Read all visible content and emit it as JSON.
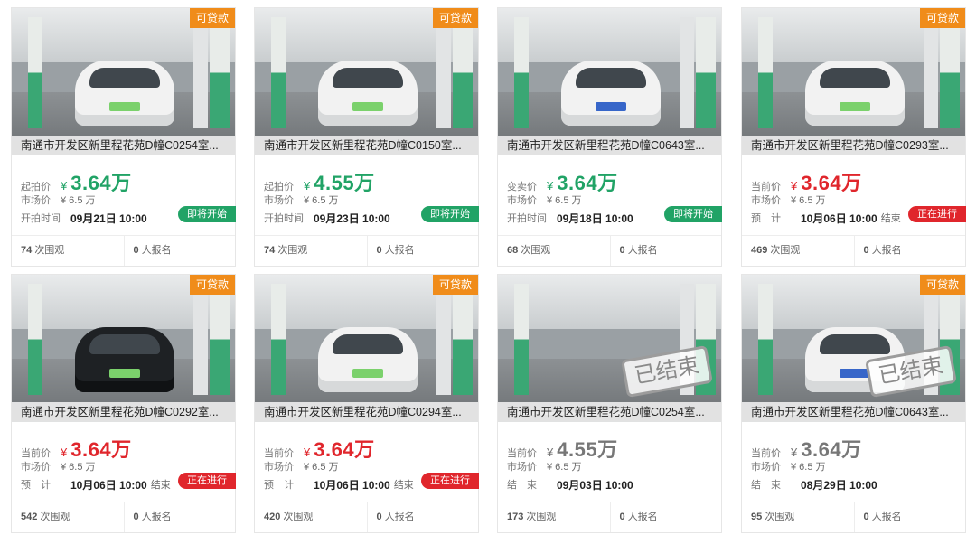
{
  "labels": {
    "market_price": "市场价",
    "views_suffix": "次围观",
    "signups_suffix": "人报名",
    "yen": "¥",
    "loan": "可贷款",
    "ended": "已结束"
  },
  "colors": {
    "green": "#21a366",
    "red": "#e0262c",
    "gray": "#777777",
    "orange": "#f08c1a"
  },
  "listings": [
    {
      "title": "南通市开发区新里程花苑D幢C0254室...",
      "price_label": "起拍价",
      "price": "3.64",
      "price_unit": "万",
      "price_color": "green",
      "market_price": "¥ 6.5 万",
      "time_label": "开拍时间",
      "time": "09月21日 10:00",
      "time_suffix": "",
      "status": "即将开始",
      "status_type": "soon",
      "views": "74",
      "signups": "0",
      "loan": true,
      "ended": false,
      "car": "light",
      "plate": "green"
    },
    {
      "title": "南通市开发区新里程花苑D幢C0150室...",
      "price_label": "起拍价",
      "price": "4.55",
      "price_unit": "万",
      "price_color": "green",
      "market_price": "¥ 6.5 万",
      "time_label": "开拍时间",
      "time": "09月23日 10:00",
      "time_suffix": "",
      "status": "即将开始",
      "status_type": "soon",
      "views": "74",
      "signups": "0",
      "loan": true,
      "ended": false,
      "car": "light",
      "plate": "green"
    },
    {
      "title": "南通市开发区新里程花苑D幢C0643室...",
      "price_label": "变卖价",
      "price": "3.64",
      "price_unit": "万",
      "price_color": "green",
      "market_price": "¥ 6.5 万",
      "time_label": "开拍时间",
      "time": "09月18日 10:00",
      "time_suffix": "",
      "status": "即将开始",
      "status_type": "soon",
      "views": "68",
      "signups": "0",
      "loan": false,
      "ended": false,
      "car": "light",
      "plate": "blue"
    },
    {
      "title": "南通市开发区新里程花苑D幢C0293室...",
      "price_label": "当前价",
      "price": "3.64",
      "price_unit": "万",
      "price_color": "red",
      "market_price": "¥ 6.5 万",
      "time_label": "预　计",
      "time": "10月06日 10:00",
      "time_suffix": "结束",
      "status": "正在进行",
      "status_type": "live",
      "views": "469",
      "signups": "0",
      "loan": true,
      "ended": false,
      "car": "light",
      "plate": "green"
    },
    {
      "title": "南通市开发区新里程花苑D幢C0292室...",
      "price_label": "当前价",
      "price": "3.64",
      "price_unit": "万",
      "price_color": "red",
      "market_price": "¥ 6.5 万",
      "time_label": "预　计",
      "time": "10月06日 10:00",
      "time_suffix": "结束",
      "status": "正在进行",
      "status_type": "live",
      "views": "542",
      "signups": "0",
      "loan": true,
      "ended": false,
      "car": "dark",
      "plate": "green"
    },
    {
      "title": "南通市开发区新里程花苑D幢C0294室...",
      "price_label": "当前价",
      "price": "3.64",
      "price_unit": "万",
      "price_color": "red",
      "market_price": "¥ 6.5 万",
      "time_label": "预　计",
      "time": "10月06日 10:00",
      "time_suffix": "结束",
      "status": "正在进行",
      "status_type": "live",
      "views": "420",
      "signups": "0",
      "loan": true,
      "ended": false,
      "car": "light",
      "plate": "green"
    },
    {
      "title": "南通市开发区新里程花苑D幢C0254室...",
      "price_label": "当前价",
      "price": "4.55",
      "price_unit": "万",
      "price_color": "gray",
      "market_price": "¥ 6.5 万",
      "time_label": "结　束",
      "time": "09月03日 10:00",
      "time_suffix": "",
      "status": "",
      "status_type": "",
      "views": "173",
      "signups": "0",
      "loan": false,
      "ended": true,
      "car": "none",
      "plate": "green"
    },
    {
      "title": "南通市开发区新里程花苑D幢C0643室...",
      "price_label": "当前价",
      "price": "3.64",
      "price_unit": "万",
      "price_color": "gray",
      "market_price": "¥ 6.5 万",
      "time_label": "结　束",
      "time": "08月29日 10:00",
      "time_suffix": "",
      "status": "",
      "status_type": "",
      "views": "95",
      "signups": "0",
      "loan": true,
      "ended": true,
      "car": "light",
      "plate": "blue"
    }
  ]
}
